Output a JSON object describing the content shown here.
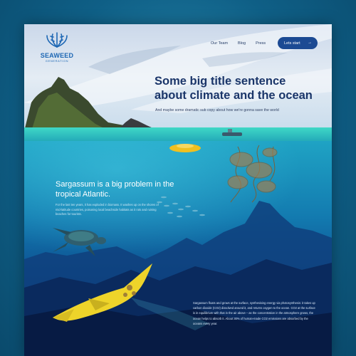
{
  "brand": {
    "name": "SEAWEED",
    "tagline": "GENERATION",
    "accent_color": "#1d67b4",
    "icon": "seaweed-wreath-icon"
  },
  "nav": {
    "items": [
      {
        "label": "Our Team"
      },
      {
        "label": "Blog"
      },
      {
        "label": "Press"
      }
    ]
  },
  "cta": {
    "label": "Lets start",
    "icon": "arrow-right-icon",
    "color": "#1c4a93"
  },
  "hero": {
    "title": "Some big title sentence about climate and the ocean",
    "subtitle": "And maybe some dramatic sub copy about how we're gonna save the world"
  },
  "section": {
    "title": "Sargassum is a big problem in the tropical Atlantic.",
    "body": "For the last ten years, it has exploded in biomass. It washes up on the shores of mid-latitude countries, poisoning local beachside habitats as it rots and ruining beaches for tourists."
  },
  "bottom": {
    "body": "Sargassum floats and grows at the surface, synthesising energy via photosynthesis: it takes up carbon dioxide (CO2) dissolved around it, and returns oxygen to the ocean. CO2 at the surface is in equilibrium with that in the air above – as the concentration in the atmosphere grows, the ocean helps to absorb it. About 30% of human-made CO2 emissions are absorbed by the oceans every year."
  }
}
